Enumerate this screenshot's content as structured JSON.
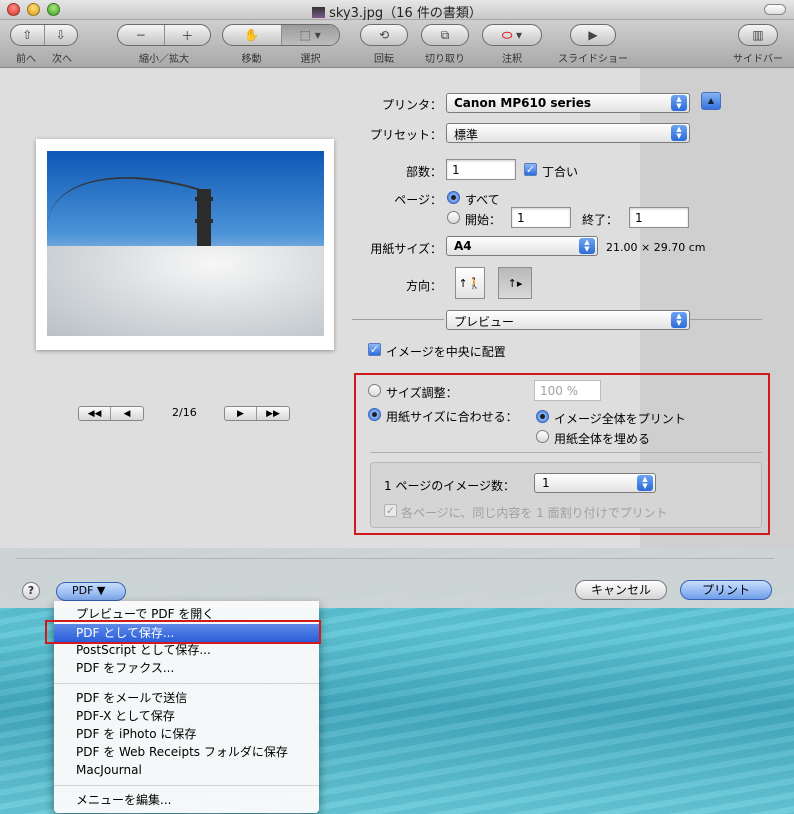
{
  "window": {
    "title": "sky3.jpg（16 件の書類）"
  },
  "toolbar": {
    "back_label": "前へ",
    "next_label": "次へ",
    "zoom_label": "縮小／拡大",
    "move_label": "移動",
    "select_label": "選択",
    "rotate_label": "回転",
    "crop_label": "切り取り",
    "annotate_label": "注釈",
    "slideshow_label": "スライドショー",
    "sidebar_label": "サイドバー"
  },
  "preview": {
    "page_indicator": "2/16"
  },
  "print": {
    "printer_label": "プリンタ：",
    "printer_value": "Canon MP610 series",
    "preset_label": "プリセット：",
    "preset_value": "標準",
    "copies_label": "部数：",
    "copies_value": "1",
    "collate_label": "丁合い",
    "collate_checked": true,
    "pages_label": "ページ：",
    "pages_all": "すべて",
    "pages_from": "開始：",
    "pages_from_value": "1",
    "pages_to": "終了：",
    "pages_to_value": "1",
    "paper_label": "用紙サイズ：",
    "paper_value": "A4",
    "paper_dims": "21.00 × 29.70 cm",
    "orientation_label": "方向：",
    "section_value": "プレビュー",
    "center_image": "イメージを中央に配置",
    "center_checked": true,
    "scale_label": "サイズ調整：",
    "scale_value": "100 %",
    "fit_label": "用紙サイズに合わせる：",
    "fit_whole": "イメージ全体をプリント",
    "fit_fill": "用紙全体を埋める",
    "per_page_label": "1 ページのイメージ数：",
    "per_page_value": "1",
    "repeat_label": "各ページに、同じ内容を 1 面割り付けでプリント"
  },
  "footer": {
    "help": "?",
    "pdf_label": "PDF ▼",
    "cancel_label": "キャンセル",
    "print_label": "プリント"
  },
  "pdf_menu": {
    "items": [
      "プレビューで PDF を開く",
      "PDF として保存...",
      "PostScript として保存...",
      "PDF をファクス...",
      "PDF をメールで送信",
      "PDF-X として保存",
      "PDF を iPhoto に保存",
      "PDF を Web Receipts フォルダに保存",
      "MacJournal",
      "メニューを編集..."
    ],
    "selected_index": 1
  },
  "colors": {
    "highlight": "#d2191e",
    "accent": "#2a5ed9"
  }
}
